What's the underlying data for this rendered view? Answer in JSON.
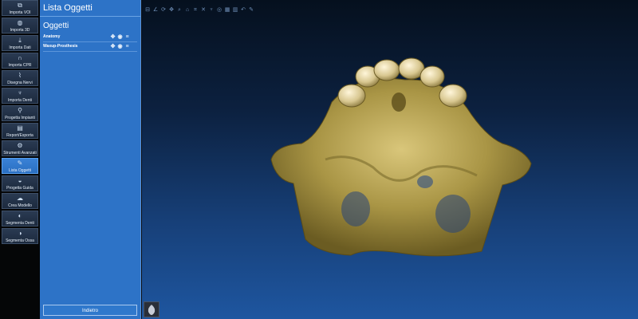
{
  "sidebar": {
    "tools": [
      {
        "label": "Importa VOI",
        "icon": "import-voi-icon"
      },
      {
        "label": "Importa 3D",
        "icon": "import-3d-icon"
      },
      {
        "label": "Importa Dati",
        "icon": "import-data-icon"
      },
      {
        "label": "Importa CPR",
        "icon": "import-cpr-icon"
      },
      {
        "label": "Disegna Nervi",
        "icon": "draw-nerves-icon"
      },
      {
        "label": "Importa Denti",
        "icon": "import-teeth-icon"
      },
      {
        "label": "Progetta Impianti",
        "icon": "design-implants-icon"
      },
      {
        "label": "Report/Esporta",
        "icon": "report-export-icon"
      },
      {
        "label": "Strumenti Avanzati",
        "icon": "advanced-tools-icon"
      },
      {
        "label": "Lista Oggetti",
        "icon": "object-list-icon"
      },
      {
        "label": "Progetta Guida",
        "icon": "design-guide-icon"
      },
      {
        "label": "Crea Modello",
        "icon": "create-model-icon"
      },
      {
        "label": "Segmenta Denti",
        "icon": "segment-teeth-icon"
      },
      {
        "label": "Segmenta Ossa",
        "icon": "segment-bones-icon"
      }
    ]
  },
  "panel": {
    "title": "Lista Oggetti",
    "section": "Oggetti",
    "objects": [
      {
        "name": "Anatomy"
      },
      {
        "name": "Waxup-Prosthesis"
      }
    ],
    "back_label": "Indietro"
  },
  "viewport": {
    "toolbar_icons": [
      "ruler-icon",
      "angle-icon",
      "rotate-icon",
      "move-icon",
      "zoom-icon",
      "reset-view-icon",
      "crop-icon",
      "cut-icon",
      "tooth-icon",
      "visibility-icon",
      "mesh-icon",
      "slice-icon",
      "undo-icon",
      "draw-icon"
    ]
  },
  "colors": {
    "panel": "#2d73c7",
    "active_tool": "#3a82d6",
    "bone": "#b8a55a"
  }
}
